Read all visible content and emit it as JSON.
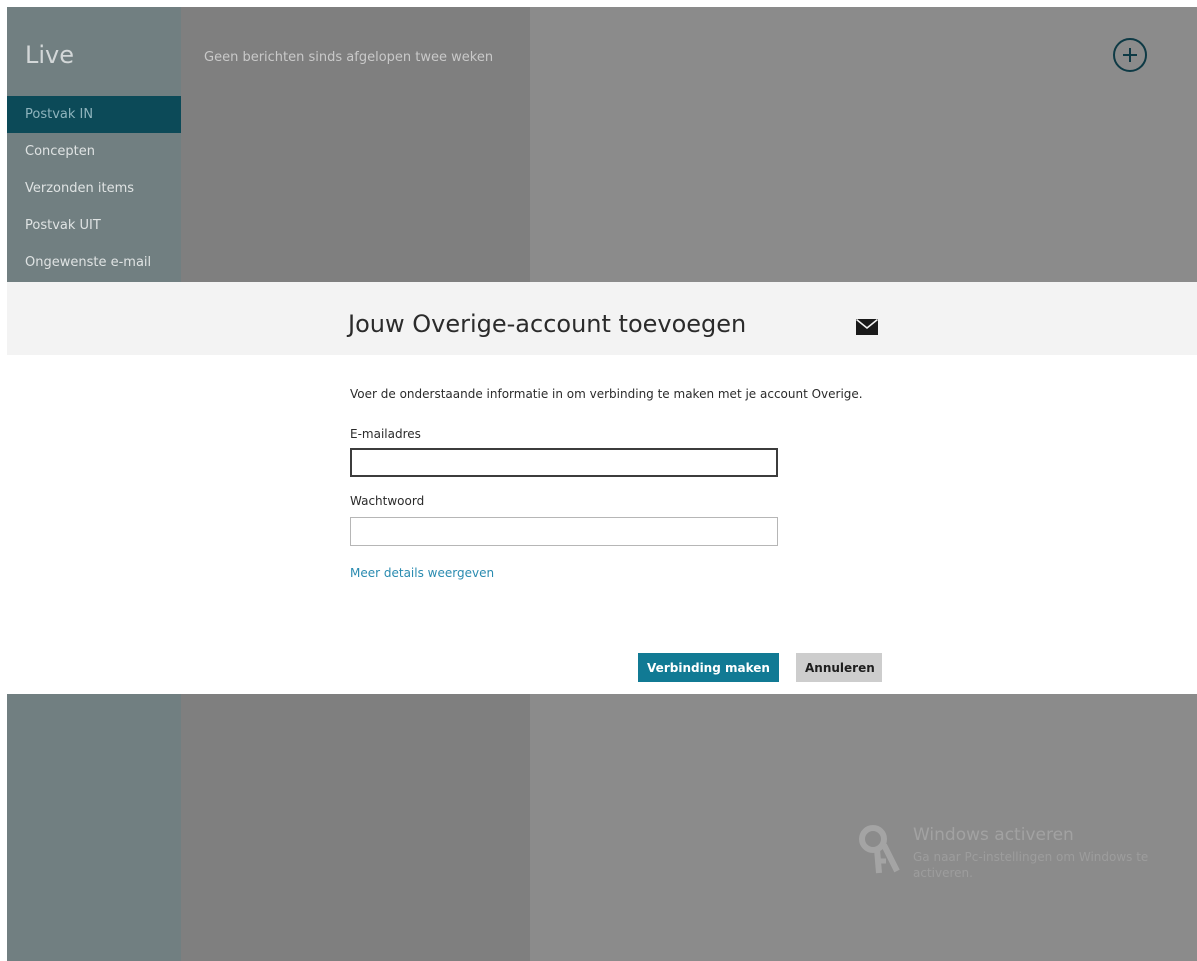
{
  "app": {
    "title": "Live"
  },
  "folders": [
    {
      "label": "Postvak IN",
      "selected": true
    },
    {
      "label": "Concepten",
      "selected": false
    },
    {
      "label": "Verzonden items",
      "selected": false
    },
    {
      "label": "Postvak UIT",
      "selected": false
    },
    {
      "label": "Ongewenste e-mail",
      "selected": false
    }
  ],
  "message_list": {
    "empty_text": "Geen berichten sinds afgelopen twee weken"
  },
  "toolbar": {
    "add_icon": "plus-circle-icon"
  },
  "dialog": {
    "title": "Jouw Overige-account toevoegen",
    "header_icon": "mail-envelope-icon",
    "description": "Voer de onderstaande informatie in om verbinding te maken met je account Overige.",
    "email_label": "E-mailadres",
    "email_value": "",
    "password_label": "Wachtwoord",
    "password_value": "",
    "details_link": "Meer details weergeven",
    "connect_label": "Verbinding maken",
    "cancel_label": "Annuleren"
  },
  "activation": {
    "title": "Windows activeren",
    "text": "Ga naar Pc-instellingen om Windows te activeren.",
    "icon": "key-icon"
  },
  "colors": {
    "selected_folder": "#0c4a58",
    "accent_button": "#117a94",
    "link": "#2a8bb0"
  }
}
